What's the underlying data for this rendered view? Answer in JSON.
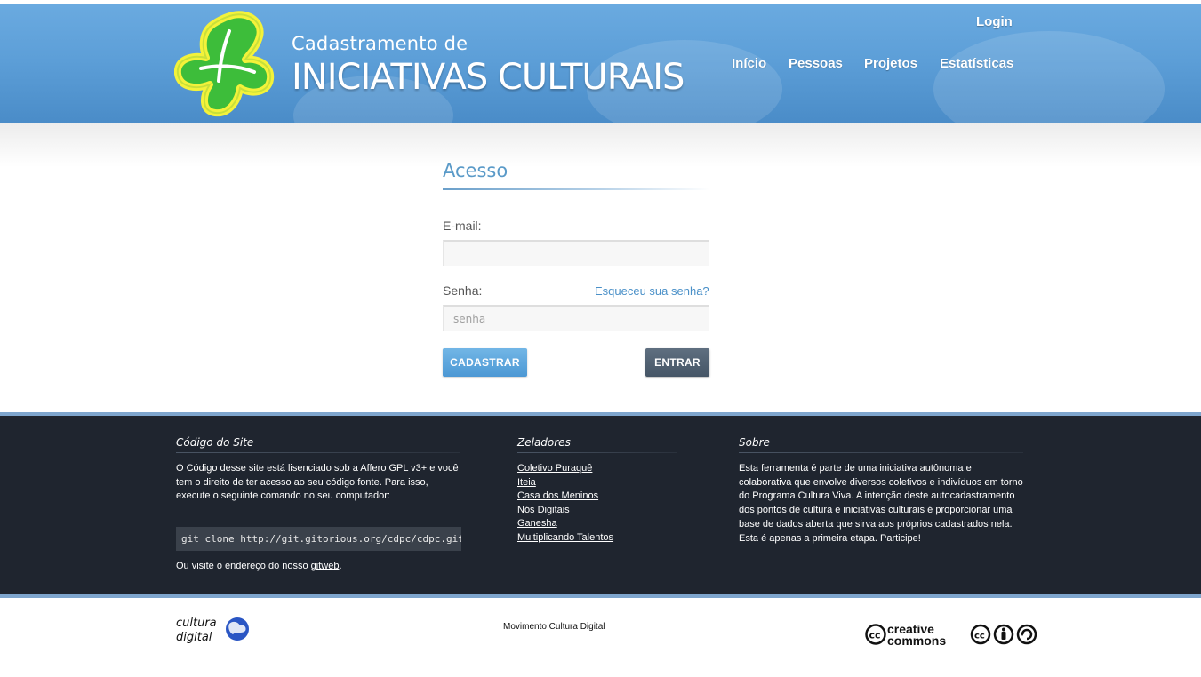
{
  "header": {
    "subtitle": "Cadastramento de",
    "title": "INICIATIVAS CULTURAIS",
    "login": "Login",
    "nav": [
      "Início",
      "Pessoas",
      "Projetos",
      "Estatísticas"
    ]
  },
  "form": {
    "title": "Acesso",
    "email_label": "E-mail:",
    "email_value": "",
    "password_label": "Senha:",
    "forgot_link": "Esqueceu sua senha?",
    "password_placeholder": "senha",
    "register_button": "CADASTRAR",
    "login_button": "ENTRAR"
  },
  "footer": {
    "code": {
      "title": "Código do Site",
      "text": "O Código desse site está lisenciado sob a Affero GPL v3+ e você tem o direito de ter acesso ao seu código fonte. Para isso, execute o seguinte comando no seu computador:",
      "command": "git clone http://git.gitorious.org/cdpc/cdpc.git",
      "visit_prefix": "Ou visite o endereço do nosso ",
      "visit_link": "gitweb",
      "visit_suffix": "."
    },
    "zeladores": {
      "title": "Zeladores",
      "items": [
        "Coletivo Puraquê",
        "Iteia",
        "Casa dos Meninos",
        "Nós Digitais",
        "Ganesha",
        "Multiplicando Talentos"
      ]
    },
    "sobre": {
      "title": "Sobre",
      "text": "Esta ferramenta é parte de uma iniciativa autônoma e colaborativa que envolve diversos coletivos e indivíduos em torno do Programa Cultura Viva. A intenção deste autocadastramento dos pontos de cultura e iniciativas culturais é proporcionar uma base de dados aberta que sirva aos próprios cadastrados nela. Esta é apenas a primeira etapa. Participe!"
    }
  },
  "bottom": {
    "center_text": "Movimento Cultura Digital",
    "left_logo_text": [
      "cultura",
      "digital"
    ],
    "right_logo_text": [
      "creative",
      "commons"
    ]
  },
  "colors": {
    "header_blue": "#5d9fd8",
    "accent_blue": "#5a9ac8",
    "footer_dark": "#1f252f",
    "footer_border": "#7ea5cd"
  }
}
